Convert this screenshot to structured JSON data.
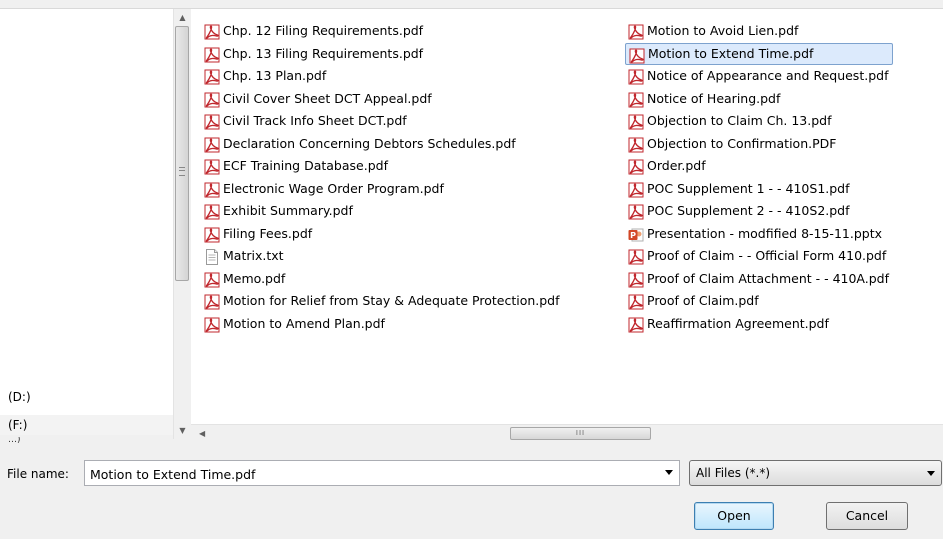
{
  "nav": {
    "drives": [
      "(D:)",
      "(F:)",
      "…)"
    ]
  },
  "files": {
    "column1": [
      {
        "name": "Chp. 12 Filing Requirements.pdf",
        "icon": "pdf-icon"
      },
      {
        "name": "Chp. 13 Filing Requirements.pdf",
        "icon": "pdf-icon"
      },
      {
        "name": "Chp. 13 Plan.pdf",
        "icon": "pdf-icon"
      },
      {
        "name": "Civil Cover Sheet DCT Appeal.pdf",
        "icon": "pdf-icon"
      },
      {
        "name": "Civil Track Info Sheet DCT.pdf",
        "icon": "pdf-icon"
      },
      {
        "name": "Declaration Concerning Debtors Schedules.pdf",
        "icon": "pdf-icon"
      },
      {
        "name": "ECF Training Database.pdf",
        "icon": "pdf-icon"
      },
      {
        "name": "Electronic Wage Order Program.pdf",
        "icon": "pdf-icon"
      },
      {
        "name": "Exhibit Summary.pdf",
        "icon": "pdf-icon"
      },
      {
        "name": "Filing Fees.pdf",
        "icon": "pdf-icon"
      },
      {
        "name": "Matrix.txt",
        "icon": "txt-icon"
      },
      {
        "name": "Memo.pdf",
        "icon": "pdf-icon"
      },
      {
        "name": "Motion for Relief from Stay & Adequate Protection.pdf",
        "icon": "pdf-icon"
      },
      {
        "name": "Motion to Amend Plan.pdf",
        "icon": "pdf-icon"
      }
    ],
    "column2": [
      {
        "name": "Motion to Avoid Lien.pdf",
        "icon": "pdf-icon"
      },
      {
        "name": "Motion to Extend Time.pdf",
        "icon": "pdf-icon",
        "selected": true
      },
      {
        "name": "Notice of Appearance and Request.pdf",
        "icon": "pdf-icon"
      },
      {
        "name": "Notice of Hearing.pdf",
        "icon": "pdf-icon"
      },
      {
        "name": "Objection to Claim Ch. 13.pdf",
        "icon": "pdf-icon"
      },
      {
        "name": "Objection to Confirmation.PDF",
        "icon": "pdf-icon"
      },
      {
        "name": "Order.pdf",
        "icon": "pdf-icon"
      },
      {
        "name": "POC Supplement 1 - - 410S1.pdf",
        "icon": "pdf-icon"
      },
      {
        "name": "POC Supplement 2 - - 410S2.pdf",
        "icon": "pdf-icon"
      },
      {
        "name": "Presentation - modfified 8-15-11.pptx",
        "icon": "pptx-icon"
      },
      {
        "name": "Proof of Claim - - Official Form 410.pdf",
        "icon": "pdf-icon"
      },
      {
        "name": "Proof of Claim Attachment - - 410A.pdf",
        "icon": "pdf-icon"
      },
      {
        "name": "Proof of Claim.pdf",
        "icon": "pdf-icon"
      },
      {
        "name": "Reaffirmation Agreement.pdf",
        "icon": "pdf-icon"
      }
    ]
  },
  "scroll": {
    "hthumb_grip": "III"
  },
  "bottom": {
    "filename_label": "File name:",
    "filename_value": "Motion to Extend Time.pdf",
    "filetype_value": "All Files (*.*)",
    "open_label": "Open",
    "cancel_label": "Cancel"
  },
  "colors": {
    "pdf_icon": "#c0272d",
    "selection_bg": "#dceafc",
    "selection_border": "#7da2ce",
    "pptx_icon": "#d24726"
  }
}
